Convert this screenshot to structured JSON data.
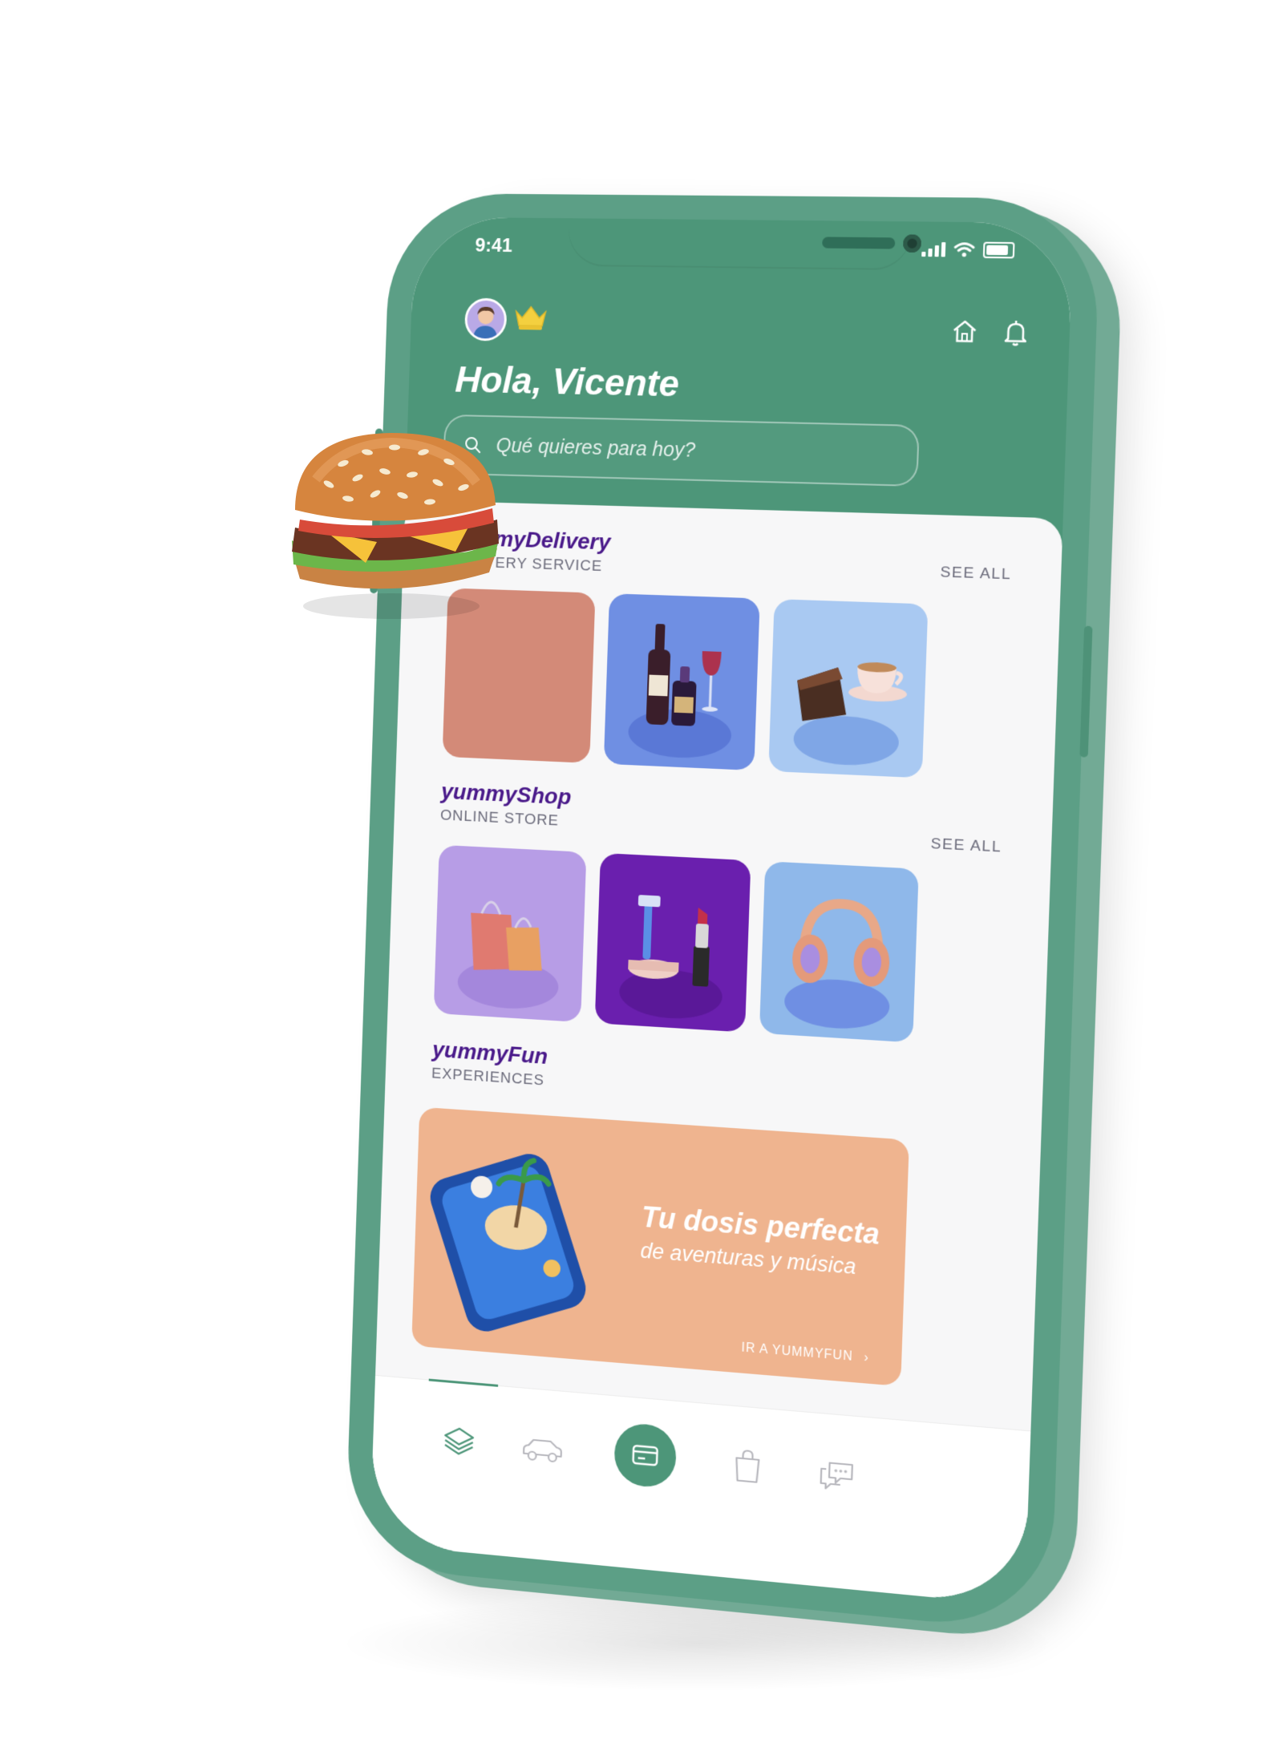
{
  "status_bar": {
    "time": "9:41"
  },
  "header": {
    "greeting": "Hola, Vicente",
    "search_placeholder": "Qué quieres para hoy?"
  },
  "sections": [
    {
      "title": "yummyDelivery",
      "subtitle": "DELIVERY SERVICE",
      "see_all": "SEE ALL"
    },
    {
      "title": "yummyShop",
      "subtitle": "ONLINE STORE",
      "see_all": "SEE ALL"
    },
    {
      "title": "yummyFun",
      "subtitle": "EXPERIENCES"
    }
  ],
  "banner": {
    "title": "Tu dosis perfecta",
    "subtitle": "de aventuras y música",
    "cta": "IR A YUMMYFUN"
  },
  "colors": {
    "brand_green": "#4d9679",
    "phone_body": "#5c9f86",
    "title_purple": "#4a1a8a",
    "banner_peach": "#efb48f"
  },
  "icons": {
    "header": [
      "avatar",
      "crown-icon",
      "home-icon",
      "bell-icon"
    ],
    "tabbar": [
      "layers-icon",
      "car-icon",
      "card-icon",
      "shopping-bag-icon",
      "chat-icon"
    ]
  }
}
